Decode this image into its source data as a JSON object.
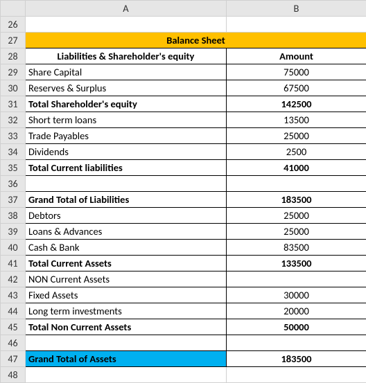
{
  "columns": {
    "a": "A",
    "b": "B"
  },
  "rownums": [
    "26",
    "27",
    "28",
    "29",
    "30",
    "31",
    "32",
    "33",
    "34",
    "35",
    "36",
    "37",
    "38",
    "39",
    "40",
    "41",
    "42",
    "43",
    "44",
    "45",
    "46",
    "47",
    "48"
  ],
  "title": "Balance Sheet",
  "header": {
    "label_col": "Liabilities & Shareholder's equity",
    "amount_col": "Amount"
  },
  "rows": {
    "share_capital": {
      "label": "Share Capital",
      "amount": "75000"
    },
    "reserves": {
      "label": "Reserves & Surplus",
      "amount": "67500"
    },
    "total_equity": {
      "label": "Total Shareholder's equity",
      "amount": "142500"
    },
    "short_term_loans": {
      "label": "Short term loans",
      "amount": "13500"
    },
    "trade_payables": {
      "label": "Trade Payables",
      "amount": "25000"
    },
    "dividends": {
      "label": "Dividends",
      "amount": "2500"
    },
    "total_current_liab": {
      "label": "Total Current liabilities",
      "amount": "41000"
    },
    "grand_total_liab": {
      "label": "Grand Total of Liabilities",
      "amount": "183500"
    },
    "debtors": {
      "label": "Debtors",
      "amount": "25000"
    },
    "loans_advances": {
      "label": "Loans & Advances",
      "amount": "25000"
    },
    "cash_bank": {
      "label": "Cash & Bank",
      "amount": "83500"
    },
    "total_current_assets": {
      "label": "Total Current Assets",
      "amount": "133500"
    },
    "non_current_assets_hdr": {
      "label": "NON Current Assets",
      "amount": ""
    },
    "fixed_assets": {
      "label": "Fixed Assets",
      "amount": "30000"
    },
    "long_term_inv": {
      "label": "Long term investments",
      "amount": "20000"
    },
    "total_non_current": {
      "label": "Total Non Current Assets",
      "amount": "50000"
    },
    "grand_total_assets": {
      "label": "Grand Total of Assets",
      "amount": "183500"
    }
  },
  "chart_data": {
    "type": "table",
    "title": "Balance Sheet",
    "columns": [
      "Liabilities & Shareholder's equity",
      "Amount"
    ],
    "rows": [
      [
        "Share Capital",
        75000
      ],
      [
        "Reserves & Surplus",
        67500
      ],
      [
        "Total Shareholder's equity",
        142500
      ],
      [
        "Short term loans",
        13500
      ],
      [
        "Trade Payables",
        25000
      ],
      [
        "Dividends",
        2500
      ],
      [
        "Total Current liabilities",
        41000
      ],
      [
        "",
        null
      ],
      [
        "Grand Total of Liabilities",
        183500
      ],
      [
        "Debtors",
        25000
      ],
      [
        "Loans & Advances",
        25000
      ],
      [
        "Cash & Bank",
        83500
      ],
      [
        "Total Current Assets",
        133500
      ],
      [
        "NON Current Assets",
        null
      ],
      [
        "Fixed Assets",
        30000
      ],
      [
        "Long term investments",
        20000
      ],
      [
        "Total Non Current Assets",
        50000
      ],
      [
        "",
        null
      ],
      [
        "Grand Total of Assets",
        183500
      ]
    ]
  }
}
